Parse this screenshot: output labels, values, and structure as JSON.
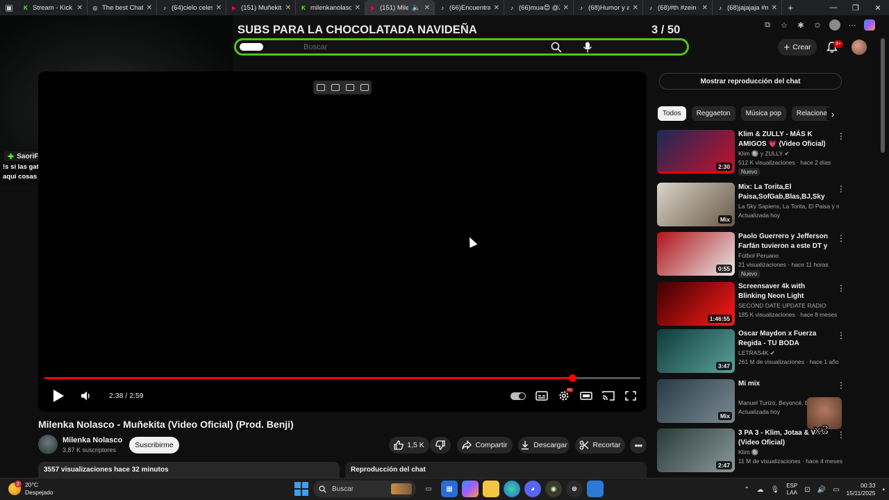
{
  "browser": {
    "tabs": [
      {
        "label": "Stream - Kick Da",
        "icon": "kick-icon",
        "color": "#53fc18",
        "active": false
      },
      {
        "label": "The best ChatBo",
        "icon": "chatgpt-icon",
        "color": "#ffffff",
        "active": false
      },
      {
        "label": "(64)cielo celeste",
        "icon": "tiktok-icon",
        "color": "#ffffff",
        "active": false
      },
      {
        "label": "(151) Muñekita -",
        "icon": "youtube-icon",
        "color": "#ff0033",
        "active": false
      },
      {
        "label": "milenkanolasco",
        "icon": "kick-icon",
        "color": "#53fc18",
        "active": false
      },
      {
        "label": "(151) Mileni",
        "icon": "youtube-icon",
        "color": "#ff0033",
        "active": true
      },
      {
        "label": "(66)Encuentra 'm",
        "icon": "tiktok-icon",
        "color": "#ffffff",
        "active": false
      },
      {
        "label": "(66)mua😍 @Zu",
        "icon": "tiktok-icon",
        "color": "#ffffff",
        "active": false
      },
      {
        "label": "(68)Humor y am",
        "icon": "tiktok-icon",
        "color": "#ffffff",
        "active": false
      },
      {
        "label": "(68)#th #zein #n",
        "icon": "tiktok-icon",
        "color": "#ffffff",
        "active": false
      },
      {
        "label": "(68)jajajaja #mat",
        "icon": "tiktok-icon",
        "color": "#ffffff",
        "active": false
      }
    ]
  },
  "overlay": {
    "title": "SUBS PARA LA CHOCOLATADA NAVIDEÑA",
    "count": "3  / 50",
    "search_placeholder": "Buscar",
    "accent": "#53c318"
  },
  "chat": {
    "username": "SaoriFlore",
    "message": "!s si las gatchurras están enfocadas en zully, no entiendo porque comentan aquí cosas nada que ver sigan en lo suyo 🐢"
  },
  "header": {
    "create_label": "Crear",
    "notifications": "9+"
  },
  "player": {
    "progress": 0.886,
    "time": "2:38 / 2:59"
  },
  "video": {
    "title": "Milenka Nolasco - Muñekita (Video Oficial) (Prod. Benji)",
    "channel": "Milenka Nolasco",
    "subscribers": "3,87 K suscriptores",
    "subscribe_label": "Suscribirme",
    "likes": "1,5 K",
    "share_label": "Compartir",
    "download_label": "Descargar",
    "clip_label": "Recortar",
    "views": "3557 visualizaciones  hace 32 minutos",
    "chat_replay_label": "Reproducción del chat"
  },
  "sidebar": {
    "replay_button": "Mostrar reproducción del chat",
    "chips": [
      "Todos",
      "Reggaeton",
      "Música pop",
      "Relaciona"
    ],
    "items": [
      {
        "title": "Klim & ZULLY - MÁS K AMIGOS 💗 (Video Oficial)",
        "channel": "Klim 🔘 y ZULLY ✔",
        "meta": "512 K visualizaciones · hace 2 días",
        "badge": "Nuevo",
        "duration": "2:30",
        "thumb": [
          "#1a2a55",
          "#c8102e"
        ]
      },
      {
        "title": "Mix: La Torita,El Paisa,SofGab,Blas,BJ,Sky ...",
        "channel": "La Sky Sapiens, La Torita, El Paisa y más",
        "meta": "Actualizada hoy",
        "badge": "",
        "duration": "Mix",
        "thumb": [
          "#d9d4c8",
          "#6a5a4a"
        ]
      },
      {
        "title": "Paolo Guerrero y Jefferson Farfán tuvieron a este DT y ...",
        "channel": "Fútbol Peruano",
        "meta": "21 visualizaciones · hace 11 horas",
        "badge": "Nuevo",
        "duration": "0:55",
        "thumb": [
          "#b0141a",
          "#e8e8e8"
        ]
      },
      {
        "title": "Screensaver 4k with Blinking Neon Light Relaxing Tunnel ...",
        "channel": "SECOND DATE UPDATE RADIO",
        "meta": "185 K visualizaciones · hace 8 meses",
        "badge": "",
        "duration": "1:46:55",
        "thumb": [
          "#3a0000",
          "#ff1a1a"
        ]
      },
      {
        "title": "Oscar Maydon x Fuerza Regida - TU BODA",
        "channel": "LETRAS4K ✔",
        "meta": "261 M de visualizaciones · hace 1 año",
        "badge": "",
        "duration": "3:47",
        "thumb": [
          "#0f3a3a",
          "#5aa09a"
        ]
      },
      {
        "title": "Mi mix",
        "channel": "Manuel Turizo, Beyoncé, Enrique Iglesias",
        "meta": "Actualizada hoy",
        "badge": "",
        "duration": "Mix",
        "thumb": [
          "#2a3a44",
          "#7a8a94"
        ]
      },
      {
        "title": "3 PA 3 - Klim, Jotaa & Vish (Video Oficial)",
        "channel": "Klim 🔘",
        "meta": "11 M de visualizaciones · hace 4 meses",
        "badge": "",
        "duration": "2:47",
        "thumb": [
          "#2a3a3a",
          "#8a9a9a"
        ]
      }
    ]
  },
  "emote": {
    "label": "x3"
  },
  "taskbar": {
    "weather_temp": "20°C",
    "weather_desc": "Despejado",
    "weather_badge": "2",
    "search_label": "Buscar",
    "lang_top": "ESP",
    "lang_bottom": "LAA",
    "time": "00:33",
    "date": "15/11/2025"
  }
}
